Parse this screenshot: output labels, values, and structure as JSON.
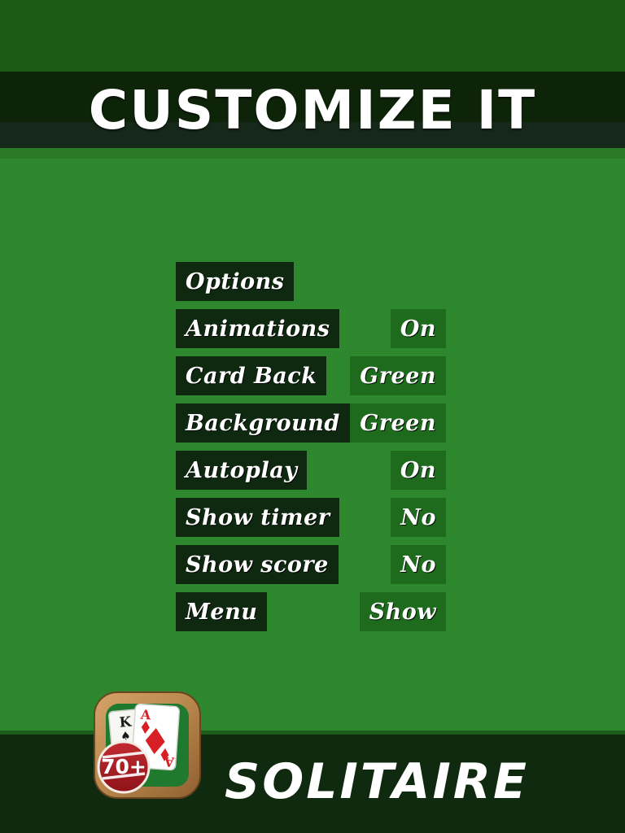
{
  "header": {
    "title": "CUSTOMIZE IT"
  },
  "options_menu": {
    "header_label": "Options",
    "rows": [
      {
        "label": "Animations",
        "value": "On"
      },
      {
        "label": "Card Back",
        "value": "Green"
      },
      {
        "label": "Background",
        "value": "Green"
      },
      {
        "label": "Autoplay",
        "value": "On"
      },
      {
        "label": "Show timer",
        "value": "No"
      },
      {
        "label": "Show score",
        "value": "No"
      },
      {
        "label": "Menu",
        "value": "Show"
      }
    ]
  },
  "footer": {
    "brand": "SOLITAIRE",
    "icon": {
      "badge_text": "70+",
      "card_back_rank": "K",
      "card_back_suit": "♠",
      "card_front_rank": "A",
      "card_front_suit": "♦"
    }
  },
  "colors": {
    "felt_green": "#2d8c2d",
    "dark_banner": "#0d2409",
    "label_box": "#0f2810",
    "value_box": "#1e6b1d",
    "text_white": "#ffffff",
    "badge_red": "#a81c22",
    "wood_frame": "#c08d52",
    "suit_red": "#d81f26"
  }
}
